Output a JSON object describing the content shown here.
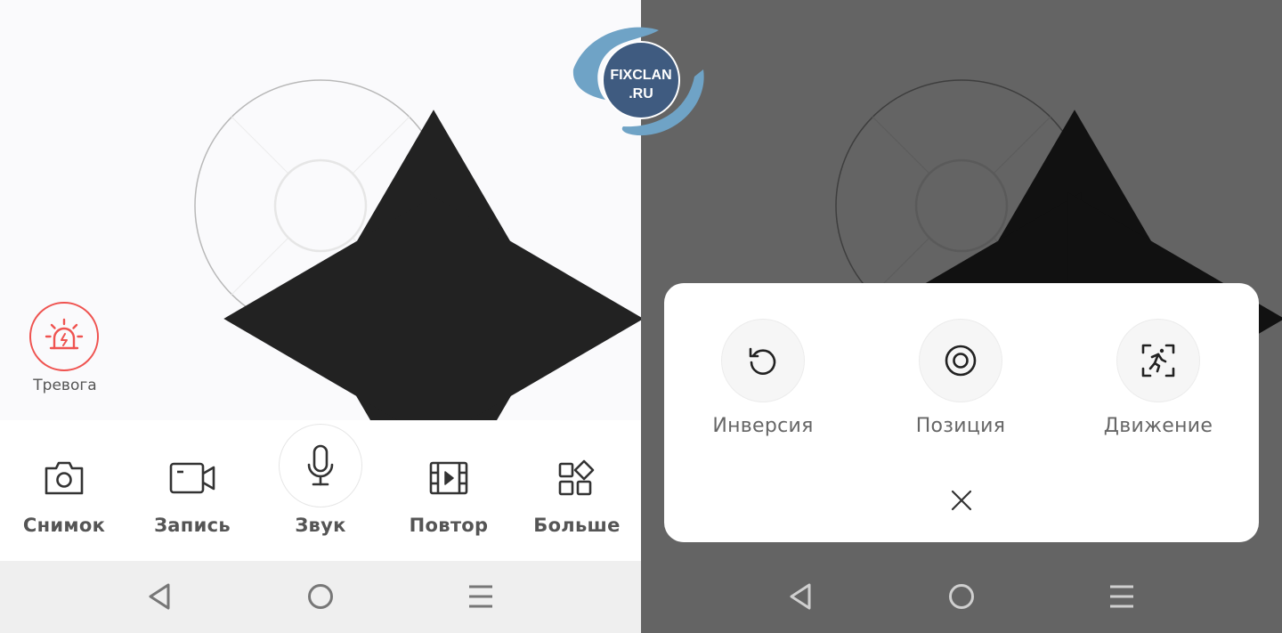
{
  "watermark": {
    "line1": "FIXCLAN",
    "line2": ".RU",
    "color_dark": "#3f5b80",
    "color_light": "#6fa3c6"
  },
  "left_panel": {
    "dpad": {
      "up_icon": "triangle-up-icon",
      "down_icon": "triangle-down-icon",
      "left_icon": "triangle-left-icon",
      "right_icon": "triangle-right-icon"
    },
    "alarm": {
      "label": "Тревога",
      "icon": "siren-icon",
      "color": "#ef5350"
    },
    "toolbar": {
      "items": [
        {
          "label": "Снимок",
          "icon": "camera-icon"
        },
        {
          "label": "Запись",
          "icon": "video-camera-icon"
        },
        {
          "label": "Звук",
          "icon": "microphone-icon"
        },
        {
          "label": "Повтор",
          "icon": "film-playback-icon"
        },
        {
          "label": "Больше",
          "icon": "more-grid-icon"
        }
      ]
    }
  },
  "right_panel": {
    "sheet": {
      "options": [
        {
          "label": "Инверсия",
          "icon": "rotate-ccw-icon"
        },
        {
          "label": "Позиция",
          "icon": "target-icon"
        },
        {
          "label": "Движение",
          "icon": "motion-detect-icon"
        }
      ],
      "close_icon": "close-icon"
    }
  },
  "system_nav": {
    "back_icon": "back-triangle-icon",
    "home_icon": "home-circle-icon",
    "menu_icon": "menu-lines-icon"
  }
}
